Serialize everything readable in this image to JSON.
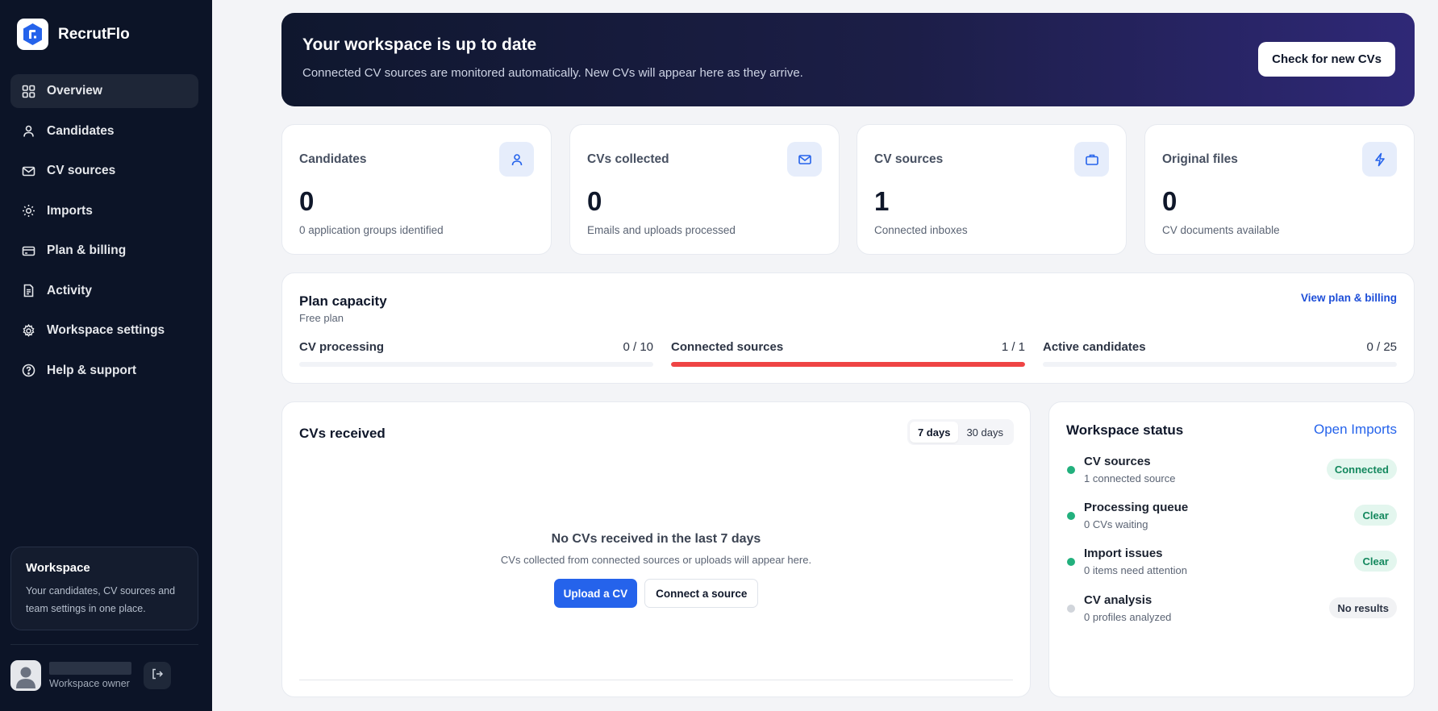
{
  "app": {
    "name": "RecrutFlo"
  },
  "sidebar": {
    "items": [
      {
        "label": "Overview",
        "icon": "grid-icon",
        "active": true
      },
      {
        "label": "Candidates",
        "icon": "user-icon"
      },
      {
        "label": "CV sources",
        "icon": "mail-icon"
      },
      {
        "label": "Imports",
        "icon": "sun-icon"
      },
      {
        "label": "Plan & billing",
        "icon": "credit-card-icon"
      },
      {
        "label": "Activity",
        "icon": "document-icon"
      },
      {
        "label": "Workspace settings",
        "icon": "gear-icon"
      },
      {
        "label": "Help & support",
        "icon": "help-icon"
      }
    ],
    "workspace_card": {
      "title": "Workspace",
      "description": "Your candidates, CV sources and team settings in one place."
    },
    "user": {
      "role": "Workspace owner"
    }
  },
  "banner": {
    "title": "Your workspace is up to date",
    "description": "Connected CV sources are monitored automatically. New CVs will appear here as they arrive.",
    "button": "Check for new CVs"
  },
  "stats": [
    {
      "label": "Candidates",
      "value": "0",
      "sub": "0 application groups identified",
      "icon": "user-icon"
    },
    {
      "label": "CVs collected",
      "value": "0",
      "sub": "Emails and uploads processed",
      "icon": "mail-icon"
    },
    {
      "label": "CV sources",
      "value": "1",
      "sub": "Connected inboxes",
      "icon": "briefcase-icon"
    },
    {
      "label": "Original files",
      "value": "0",
      "sub": "CV documents available",
      "icon": "bolt-icon"
    }
  ],
  "plan": {
    "title": "Plan capacity",
    "subtitle": "Free plan",
    "link": "View plan & billing",
    "meters": [
      {
        "label": "CV processing",
        "value": "0 / 10",
        "fraction": 0.0
      },
      {
        "label": "Connected sources",
        "value": "1 / 1",
        "fraction": 1.0
      },
      {
        "label": "Active candidates",
        "value": "0 / 25",
        "fraction": 0.0
      }
    ]
  },
  "cvs_received": {
    "title": "CVs received",
    "ranges": [
      "7 days",
      "30 days"
    ],
    "selected_range": "7 days",
    "empty_title": "No CVs received in the last 7 days",
    "empty_text": "CVs collected from connected sources or uploads will appear here.",
    "primary_button": "Upload a CV",
    "secondary_button": "Connect a source"
  },
  "workspace_status": {
    "title": "Workspace status",
    "link": "Open Imports",
    "rows": [
      {
        "name": "CV sources",
        "sub": "1 connected source",
        "badge": "Connected",
        "state": "ok"
      },
      {
        "name": "Processing queue",
        "sub": "0 CVs waiting",
        "badge": "Clear",
        "state": "ok"
      },
      {
        "name": "Import issues",
        "sub": "0 items need attention",
        "badge": "Clear",
        "state": "ok"
      },
      {
        "name": "CV analysis",
        "sub": "0 profiles analyzed",
        "badge": "No results",
        "state": "neutral"
      }
    ]
  },
  "colors": {
    "sidebar_bg": "#0c1427",
    "accent_blue": "#2563eb",
    "danger_red": "#ef4444",
    "success_green": "#22b07d",
    "success_badge_bg": "#e3f6ee",
    "success_badge_text": "#14885e"
  }
}
